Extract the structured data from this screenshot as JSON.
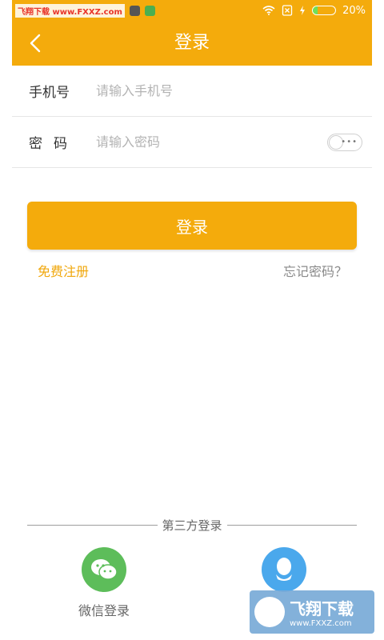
{
  "status_bar": {
    "watermark": "飞翔下载 www.FXXZ.com",
    "battery_percent": "20%",
    "battery_level": 0.2,
    "colors": {
      "bar": "#f4ab0c",
      "battery_fill": "#6ee05a"
    }
  },
  "header": {
    "back_icon": "chevron-left-icon",
    "title": "登录"
  },
  "form": {
    "phone": {
      "label": "手机号",
      "placeholder": "请输入手机号",
      "value": ""
    },
    "password": {
      "label": "密码",
      "placeholder": "请输入密码",
      "value": "",
      "visibility_toggle_icon": "toggle-switch-icon"
    }
  },
  "actions": {
    "login_label": "登录",
    "register_label": "免费注册",
    "forgot_label": "忘记密码？"
  },
  "third_party": {
    "title": "第三方登录",
    "options": [
      {
        "label": "微信登录",
        "icon": "wechat-icon",
        "color": "#5dbd5a"
      },
      {
        "label": "",
        "icon": "qq-icon",
        "color": "#4aa8ec"
      }
    ]
  },
  "bottom_watermark": {
    "text": "飞翔下载",
    "url": "www.FXXZ.com"
  },
  "colors": {
    "accent": "#f4ab0c",
    "link": "#f0a70b"
  }
}
